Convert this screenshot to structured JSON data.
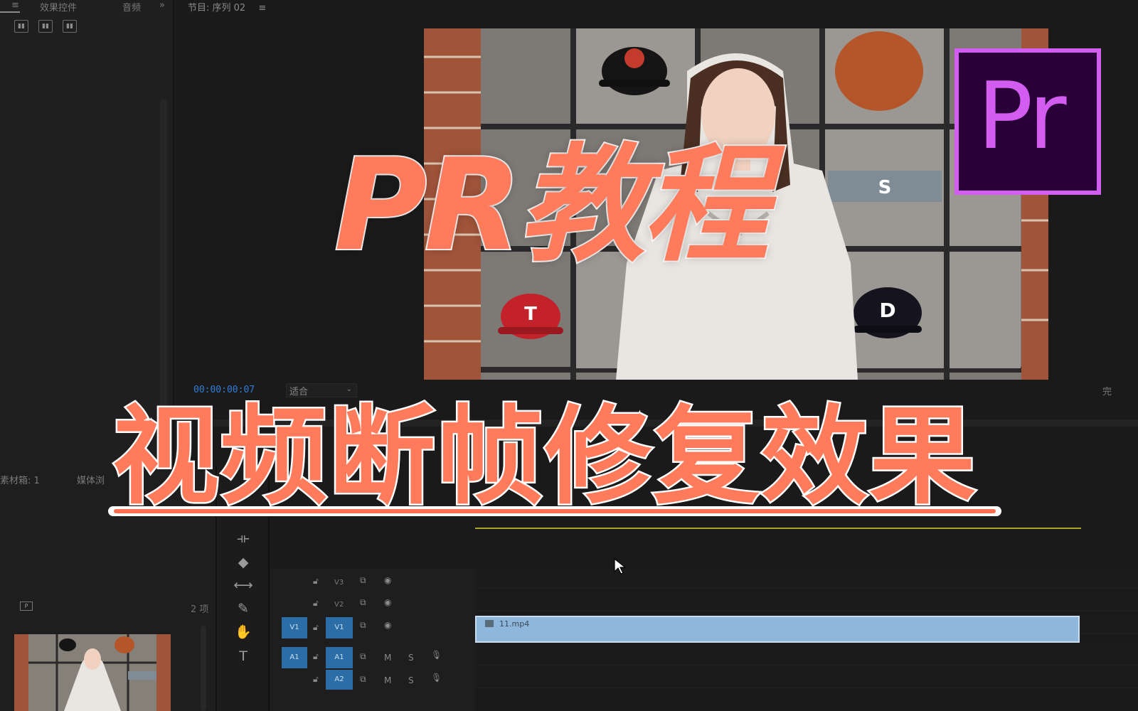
{
  "left_panel": {
    "tab_menu_glyph": "≡",
    "tab_effect_controls": "效果控件",
    "tab_audio": "音频",
    "tab_overflow": "»"
  },
  "monitor": {
    "tab_label": "节目: 序列 02",
    "tab_menu_glyph": "≡",
    "timecode": "00:00:00:07",
    "fit_label": "适合",
    "full_label": "完"
  },
  "project": {
    "tab_media": "素材箱: 1",
    "tab_browser": "媒体浏",
    "item_count": "2 项"
  },
  "tracks": {
    "v3": "V3",
    "v2": "V2",
    "v1": "V1",
    "a1": "A1",
    "a2": "A2",
    "mute": "M",
    "solo": "S"
  },
  "clip": {
    "name": "11.mp4"
  },
  "overlay": {
    "title_line1": "PR教程",
    "title_line2": "视频断帧修复效果"
  },
  "logo": {
    "text": "Pr"
  },
  "colors": {
    "accent_orange": "#ff7b5c",
    "pr_purple": "#d35cf1",
    "pr_bg": "#2a0038",
    "clip_blue": "#8fb7dc",
    "track_blue": "#2b6ea7",
    "timecode_blue": "#2f7ed8"
  }
}
